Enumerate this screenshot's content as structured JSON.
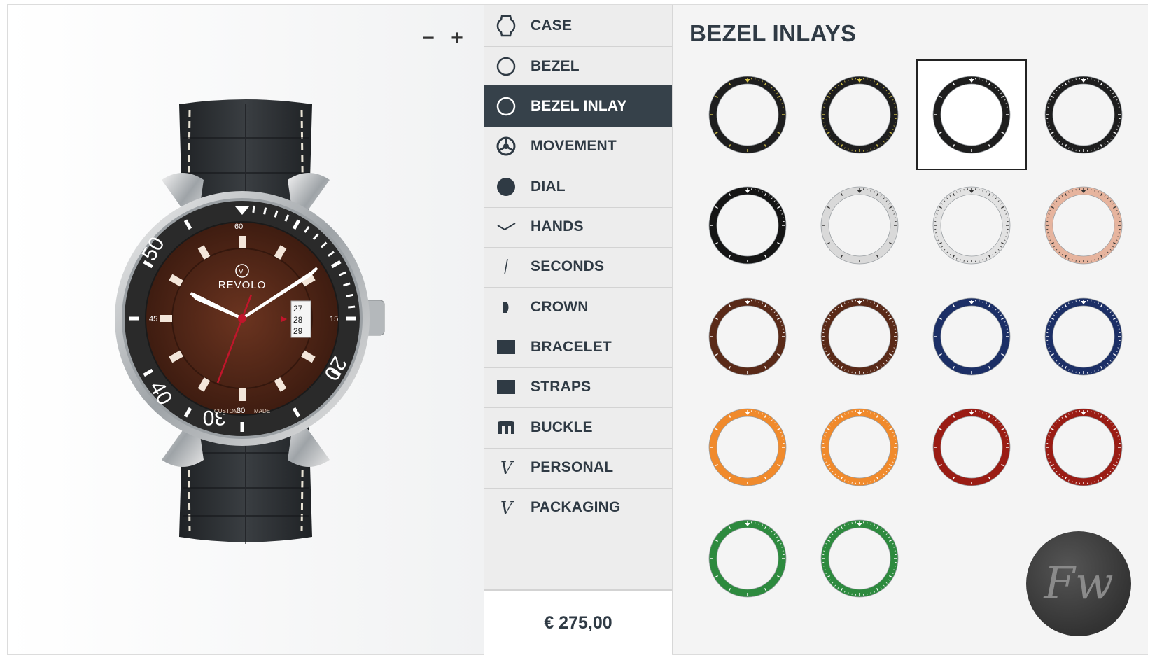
{
  "zoom": {
    "minus": "−",
    "plus": "+"
  },
  "watch": {
    "brand": "REVOLO",
    "bezel_numbers": [
      "50",
      "40",
      "30",
      "20"
    ],
    "dial_numbers": [
      "60",
      "45",
      "15",
      "30"
    ],
    "dial_bottom_text": [
      "CUSTOM",
      "MADE"
    ],
    "date": [
      "27",
      "28",
      "29"
    ],
    "colors": {
      "dial": "#4a2316",
      "bezel": "#2a2a2a",
      "strap": "#2b2e31",
      "accent": "#c0162b"
    }
  },
  "menu": {
    "items": [
      {
        "label": "CASE",
        "icon": "case-icon",
        "active": false
      },
      {
        "label": "BEZEL",
        "icon": "bezel-icon",
        "active": false
      },
      {
        "label": "BEZEL INLAY",
        "icon": "bezel-inlay-icon",
        "active": true
      },
      {
        "label": "MOVEMENT",
        "icon": "movement-icon",
        "active": false
      },
      {
        "label": "DIAL",
        "icon": "dial-icon",
        "active": false
      },
      {
        "label": "HANDS",
        "icon": "hands-icon",
        "active": false
      },
      {
        "label": "SECONDS",
        "icon": "seconds-icon",
        "active": false
      },
      {
        "label": "CROWN",
        "icon": "crown-icon",
        "active": false
      },
      {
        "label": "BRACELET",
        "icon": "bracelet-icon",
        "active": false
      },
      {
        "label": "STRAPS",
        "icon": "straps-icon",
        "active": false
      },
      {
        "label": "BUCKLE",
        "icon": "buckle-icon",
        "active": false
      },
      {
        "label": "PERSONAL",
        "icon": "personal-icon",
        "active": false
      },
      {
        "label": "PACKAGING",
        "icon": "packaging-icon",
        "active": false
      }
    ],
    "price": "€ 275,00"
  },
  "options": {
    "title": "BEZEL INLAYS",
    "inlays": [
      {
        "ring": "#1e1e1e",
        "ink": "#d6c34a",
        "style": "diver",
        "selected": false
      },
      {
        "ring": "#1e1e1e",
        "ink": "#d6c34a",
        "style": "gmt",
        "selected": false
      },
      {
        "ring": "#1e1e1e",
        "ink": "#ffffff",
        "style": "diver",
        "selected": true
      },
      {
        "ring": "#1e1e1e",
        "ink": "#ffffff",
        "style": "gmt",
        "selected": false
      },
      {
        "ring": "#151515",
        "ink": "#ffffff",
        "style": "diver",
        "selected": false
      },
      {
        "ring": "#d9d9d9",
        "ink": "#333333",
        "style": "diver",
        "selected": false
      },
      {
        "ring": "#e2e2e2",
        "ink": "#333333",
        "style": "gmt",
        "selected": false
      },
      {
        "ring": "#e6b49e",
        "ink": "#333333",
        "style": "gmt",
        "selected": false
      },
      {
        "ring": "#5a2a18",
        "ink": "#ffffff",
        "style": "diver",
        "selected": false
      },
      {
        "ring": "#5a2a18",
        "ink": "#ffffff",
        "style": "gmt",
        "selected": false
      },
      {
        "ring": "#1c2f66",
        "ink": "#ffffff",
        "style": "diver",
        "selected": false
      },
      {
        "ring": "#1c2f66",
        "ink": "#ffffff",
        "style": "gmt",
        "selected": false
      },
      {
        "ring": "#f08a2c",
        "ink": "#ffffff",
        "style": "diver",
        "selected": false
      },
      {
        "ring": "#f08a2c",
        "ink": "#ffffff",
        "style": "gmt",
        "selected": false
      },
      {
        "ring": "#9a1c14",
        "ink": "#ffffff",
        "style": "diver",
        "selected": false
      },
      {
        "ring": "#9a1c14",
        "ink": "#ffffff",
        "style": "gmt",
        "selected": false
      },
      {
        "ring": "#2d8a3e",
        "ink": "#ffffff",
        "style": "diver",
        "selected": false
      },
      {
        "ring": "#2d8a3e",
        "ink": "#ffffff",
        "style": "gmt",
        "selected": false
      }
    ],
    "logo_text": "Fw"
  }
}
